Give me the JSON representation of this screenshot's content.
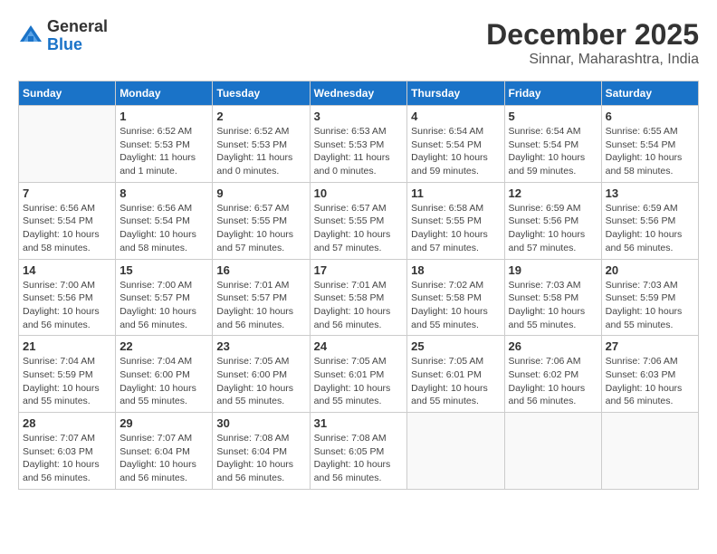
{
  "logo": {
    "general": "General",
    "blue": "Blue"
  },
  "header": {
    "month": "December 2025",
    "location": "Sinnar, Maharashtra, India"
  },
  "weekdays": [
    "Sunday",
    "Monday",
    "Tuesday",
    "Wednesday",
    "Thursday",
    "Friday",
    "Saturday"
  ],
  "weeks": [
    [
      {
        "day": "",
        "info": ""
      },
      {
        "day": "1",
        "info": "Sunrise: 6:52 AM\nSunset: 5:53 PM\nDaylight: 11 hours\nand 1 minute."
      },
      {
        "day": "2",
        "info": "Sunrise: 6:52 AM\nSunset: 5:53 PM\nDaylight: 11 hours\nand 0 minutes."
      },
      {
        "day": "3",
        "info": "Sunrise: 6:53 AM\nSunset: 5:53 PM\nDaylight: 11 hours\nand 0 minutes."
      },
      {
        "day": "4",
        "info": "Sunrise: 6:54 AM\nSunset: 5:54 PM\nDaylight: 10 hours\nand 59 minutes."
      },
      {
        "day": "5",
        "info": "Sunrise: 6:54 AM\nSunset: 5:54 PM\nDaylight: 10 hours\nand 59 minutes."
      },
      {
        "day": "6",
        "info": "Sunrise: 6:55 AM\nSunset: 5:54 PM\nDaylight: 10 hours\nand 58 minutes."
      }
    ],
    [
      {
        "day": "7",
        "info": "Sunrise: 6:56 AM\nSunset: 5:54 PM\nDaylight: 10 hours\nand 58 minutes."
      },
      {
        "day": "8",
        "info": "Sunrise: 6:56 AM\nSunset: 5:54 PM\nDaylight: 10 hours\nand 58 minutes."
      },
      {
        "day": "9",
        "info": "Sunrise: 6:57 AM\nSunset: 5:55 PM\nDaylight: 10 hours\nand 57 minutes."
      },
      {
        "day": "10",
        "info": "Sunrise: 6:57 AM\nSunset: 5:55 PM\nDaylight: 10 hours\nand 57 minutes."
      },
      {
        "day": "11",
        "info": "Sunrise: 6:58 AM\nSunset: 5:55 PM\nDaylight: 10 hours\nand 57 minutes."
      },
      {
        "day": "12",
        "info": "Sunrise: 6:59 AM\nSunset: 5:56 PM\nDaylight: 10 hours\nand 57 minutes."
      },
      {
        "day": "13",
        "info": "Sunrise: 6:59 AM\nSunset: 5:56 PM\nDaylight: 10 hours\nand 56 minutes."
      }
    ],
    [
      {
        "day": "14",
        "info": "Sunrise: 7:00 AM\nSunset: 5:56 PM\nDaylight: 10 hours\nand 56 minutes."
      },
      {
        "day": "15",
        "info": "Sunrise: 7:00 AM\nSunset: 5:57 PM\nDaylight: 10 hours\nand 56 minutes."
      },
      {
        "day": "16",
        "info": "Sunrise: 7:01 AM\nSunset: 5:57 PM\nDaylight: 10 hours\nand 56 minutes."
      },
      {
        "day": "17",
        "info": "Sunrise: 7:01 AM\nSunset: 5:58 PM\nDaylight: 10 hours\nand 56 minutes."
      },
      {
        "day": "18",
        "info": "Sunrise: 7:02 AM\nSunset: 5:58 PM\nDaylight: 10 hours\nand 55 minutes."
      },
      {
        "day": "19",
        "info": "Sunrise: 7:03 AM\nSunset: 5:58 PM\nDaylight: 10 hours\nand 55 minutes."
      },
      {
        "day": "20",
        "info": "Sunrise: 7:03 AM\nSunset: 5:59 PM\nDaylight: 10 hours\nand 55 minutes."
      }
    ],
    [
      {
        "day": "21",
        "info": "Sunrise: 7:04 AM\nSunset: 5:59 PM\nDaylight: 10 hours\nand 55 minutes."
      },
      {
        "day": "22",
        "info": "Sunrise: 7:04 AM\nSunset: 6:00 PM\nDaylight: 10 hours\nand 55 minutes."
      },
      {
        "day": "23",
        "info": "Sunrise: 7:05 AM\nSunset: 6:00 PM\nDaylight: 10 hours\nand 55 minutes."
      },
      {
        "day": "24",
        "info": "Sunrise: 7:05 AM\nSunset: 6:01 PM\nDaylight: 10 hours\nand 55 minutes."
      },
      {
        "day": "25",
        "info": "Sunrise: 7:05 AM\nSunset: 6:01 PM\nDaylight: 10 hours\nand 55 minutes."
      },
      {
        "day": "26",
        "info": "Sunrise: 7:06 AM\nSunset: 6:02 PM\nDaylight: 10 hours\nand 56 minutes."
      },
      {
        "day": "27",
        "info": "Sunrise: 7:06 AM\nSunset: 6:03 PM\nDaylight: 10 hours\nand 56 minutes."
      }
    ],
    [
      {
        "day": "28",
        "info": "Sunrise: 7:07 AM\nSunset: 6:03 PM\nDaylight: 10 hours\nand 56 minutes."
      },
      {
        "day": "29",
        "info": "Sunrise: 7:07 AM\nSunset: 6:04 PM\nDaylight: 10 hours\nand 56 minutes."
      },
      {
        "day": "30",
        "info": "Sunrise: 7:08 AM\nSunset: 6:04 PM\nDaylight: 10 hours\nand 56 minutes."
      },
      {
        "day": "31",
        "info": "Sunrise: 7:08 AM\nSunset: 6:05 PM\nDaylight: 10 hours\nand 56 minutes."
      },
      {
        "day": "",
        "info": ""
      },
      {
        "day": "",
        "info": ""
      },
      {
        "day": "",
        "info": ""
      }
    ]
  ]
}
